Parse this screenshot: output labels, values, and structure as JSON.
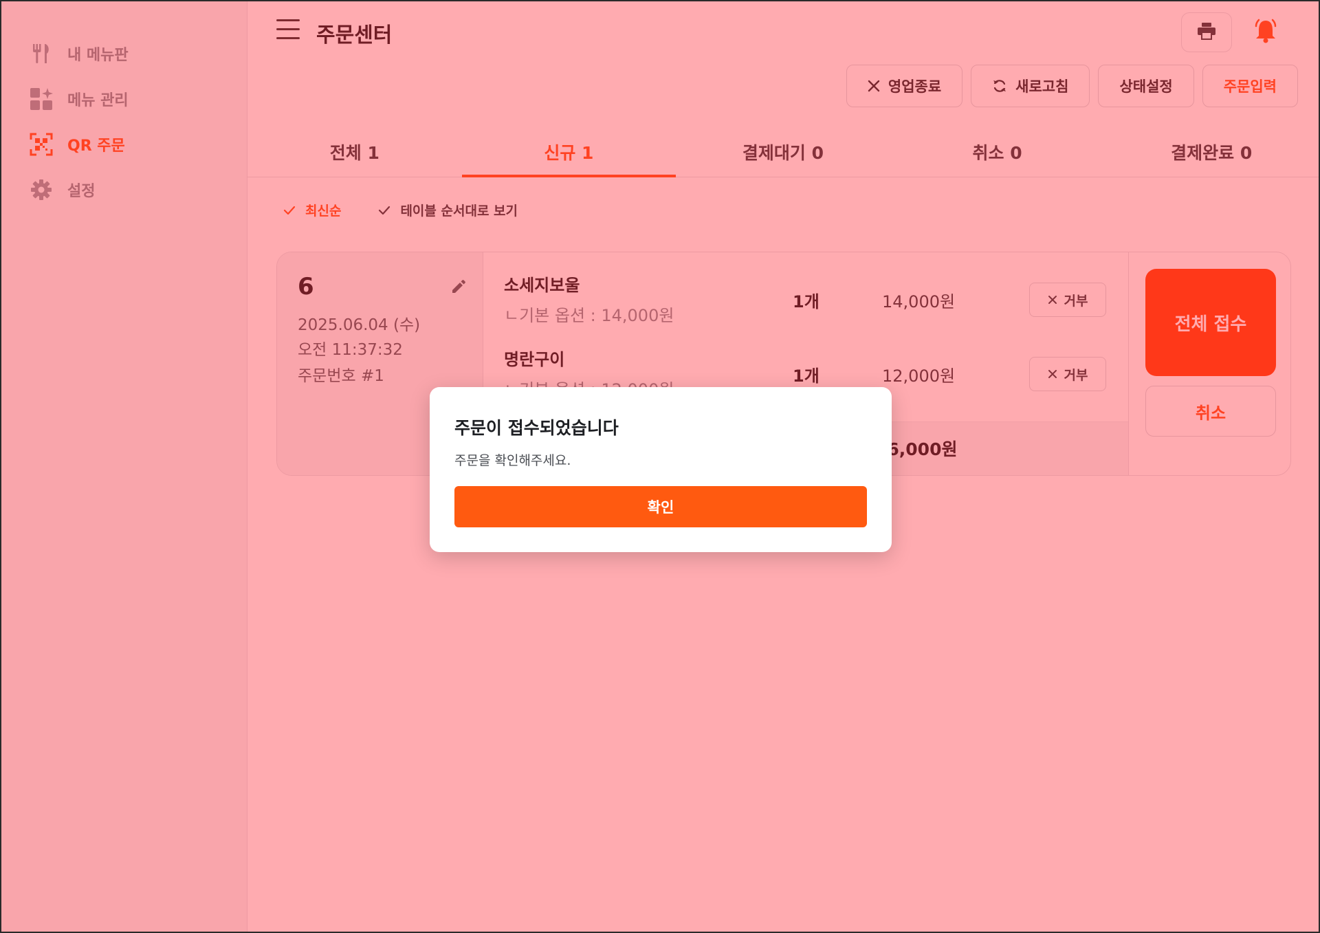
{
  "sidebar": {
    "items": [
      {
        "label": "내 메뉴판",
        "icon": "utensils-icon"
      },
      {
        "label": "메뉴 관리",
        "icon": "grid-sparkle-icon"
      },
      {
        "label": "QR 주문",
        "icon": "qr-code-icon",
        "active": true
      },
      {
        "label": "설정",
        "icon": "gear-icon"
      }
    ]
  },
  "header": {
    "title": "주문센터"
  },
  "actions": {
    "close_business": "영업종료",
    "refresh": "새로고침",
    "status_setting": "상태설정",
    "order_input": "주문입력"
  },
  "tabs": [
    {
      "label": "전체 1"
    },
    {
      "label": "신규 1",
      "active": true
    },
    {
      "label": "결제대기 0"
    },
    {
      "label": "취소 0"
    },
    {
      "label": "결제완료 0"
    }
  ],
  "sort": {
    "latest": "최신순",
    "by_table": "테이블 순서대로 보기"
  },
  "order": {
    "table_no": "6",
    "date": "2025.06.04 (수)",
    "time": "오전 11:37:32",
    "order_no": "주문번호 #1",
    "items": [
      {
        "name": "소세지보울",
        "option": "ㄴ기본 옵션 : 14,000원",
        "qty": "1개",
        "price": "14,000원",
        "reject": "거부"
      },
      {
        "name": "명란구이",
        "option": "ㄴ기본 옵션 : 12,000원",
        "qty": "1개",
        "price": "12,000원",
        "reject": "거부"
      }
    ],
    "total": "26,000원",
    "accept_all": "전체 접수",
    "cancel": "취소"
  },
  "modal": {
    "title": "주문이 접수되었습니다",
    "message": "주문을 확인해주세요.",
    "ok": "확인"
  },
  "colors": {
    "accent": "#ff5a1f",
    "overlay": "#ff1c28"
  }
}
